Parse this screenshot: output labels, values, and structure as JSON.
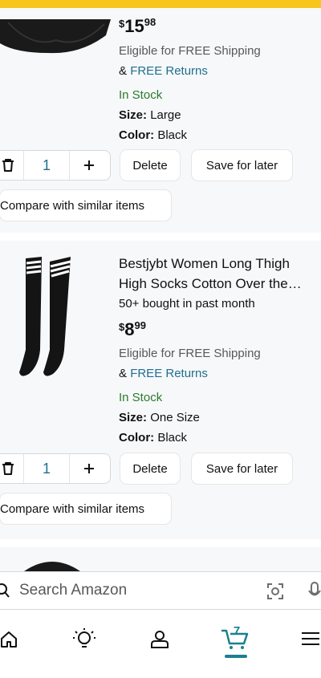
{
  "item1": {
    "price": {
      "symbol": "$",
      "whole": "15",
      "fraction": "98"
    },
    "shipping": "Eligible for FREE Shipping",
    "returns_prefix": "& ",
    "returns": "FREE Returns",
    "stock": "In Stock",
    "size_label": "Size:",
    "size_value": "Large",
    "color_label": "Color:",
    "color_value": "Black",
    "quantity": "1",
    "delete_label": "Delete",
    "save_label": "Save for later",
    "compare_label": "Compare with similar items"
  },
  "item2": {
    "title_line1": "Bestjybt Women Long Thigh",
    "title_line2": "High Socks Cotton Over the…",
    "bought": "50+ bought in past month",
    "price": {
      "symbol": "$",
      "whole": "8",
      "fraction": "99"
    },
    "shipping": "Eligible for FREE Shipping",
    "returns_prefix": "& ",
    "returns": "FREE Returns",
    "stock": "In Stock",
    "size_label": "Size:",
    "size_value": "One Size",
    "color_label": "Color:",
    "color_value": "Black",
    "quantity": "1",
    "delete_label": "Delete",
    "save_label": "Save for later",
    "compare_label": "Compare with similar items"
  },
  "search": {
    "placeholder": "Search Amazon"
  },
  "nav": {
    "cart_count": "7"
  },
  "colors": {
    "accent_yellow": "#f6c61b",
    "link_blue": "#1f6f8f",
    "in_stock_green": "#2a7b2a",
    "nav_underline": "#1b7f8f"
  }
}
